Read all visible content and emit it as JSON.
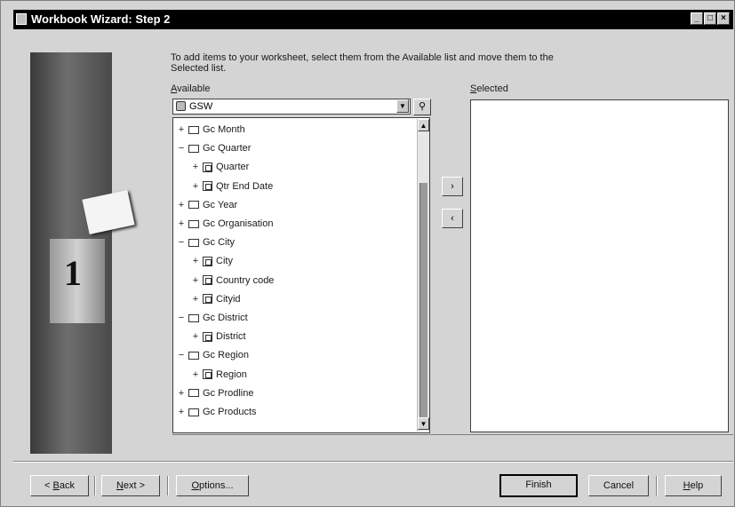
{
  "window": {
    "title": "Workbook Wizard: Step 2",
    "controls": [
      "minimize-icon",
      "maximize-icon",
      "close-icon"
    ]
  },
  "instructions": "To add items to your worksheet, select them from the Available list and move them to the Selected list.",
  "available": {
    "label": "Available",
    "label_hotkey": "A",
    "combo_value": "GSW",
    "find_icon": "flashlight-find-icon"
  },
  "selected": {
    "label": "Selected",
    "label_hotkey": "S"
  },
  "tree": [
    {
      "name": "Gc Month",
      "expander": "+",
      "type": "folder",
      "level": 0
    },
    {
      "name": "Gc Quarter",
      "expander": "−",
      "type": "folder",
      "level": 0
    },
    {
      "name": "Quarter",
      "expander": "+",
      "type": "item",
      "level": 1
    },
    {
      "name": "Qtr End Date",
      "expander": "+",
      "type": "item",
      "level": 1
    },
    {
      "name": "Gc Year",
      "expander": "+",
      "type": "folder",
      "level": 0
    },
    {
      "name": "Gc Organisation",
      "expander": "+",
      "type": "folder",
      "level": 0
    },
    {
      "name": "Gc City",
      "expander": "−",
      "type": "folder",
      "level": 0
    },
    {
      "name": "City",
      "expander": "+",
      "type": "item",
      "level": 1
    },
    {
      "name": "Country code",
      "expander": "+",
      "type": "item",
      "level": 1
    },
    {
      "name": "Cityid",
      "expander": "+",
      "type": "item",
      "level": 1
    },
    {
      "name": "Gc District",
      "expander": "−",
      "type": "folder",
      "level": 0
    },
    {
      "name": "District",
      "expander": "+",
      "type": "item",
      "level": 1
    },
    {
      "name": "Gc Region",
      "expander": "−",
      "type": "folder",
      "level": 0
    },
    {
      "name": "Region",
      "expander": "+",
      "type": "item",
      "level": 1
    },
    {
      "name": "Gc Prodline",
      "expander": "+",
      "type": "folder",
      "level": 0
    },
    {
      "name": "Gc Products",
      "expander": "+",
      "type": "folder",
      "level": 0
    }
  ],
  "move_buttons": {
    "add": "›",
    "remove": "‹"
  },
  "buttons": {
    "back": {
      "prefix": "< ",
      "hotkey": "B",
      "rest": "ack"
    },
    "next": {
      "hotkey": "N",
      "rest": "ext >"
    },
    "options": {
      "hotkey": "O",
      "rest": "ptions..."
    },
    "finish": "Finish",
    "cancel": "Cancel",
    "help": {
      "hotkey": "H",
      "rest": "elp"
    }
  }
}
